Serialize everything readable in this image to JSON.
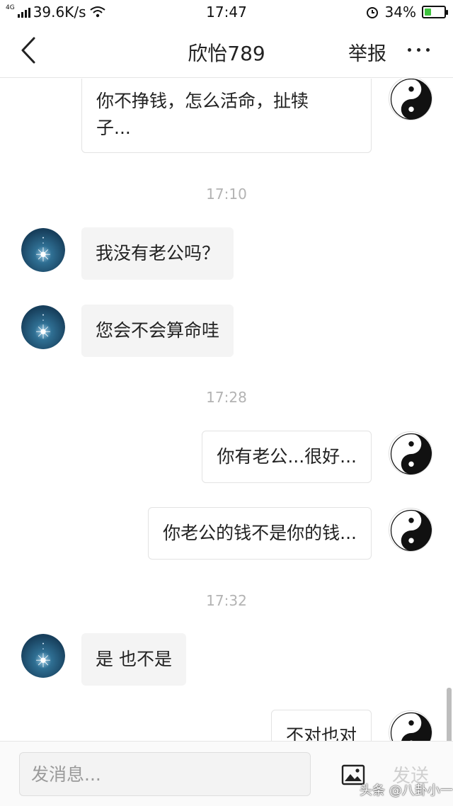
{
  "status_bar": {
    "network": "4G",
    "speed": "39.6K/s",
    "time": "17:47",
    "battery": "34%",
    "battery_level": 0.34,
    "icons": [
      "signal-icon",
      "wifi-icon",
      "alarm-icon",
      "battery-charging-icon"
    ]
  },
  "header": {
    "back_icon": "chevron-left-icon",
    "title": "欣怡789",
    "report_label": "举报",
    "more_icon": "more-dots-icon"
  },
  "messages": [
    {
      "side": "out",
      "text": "你不挣钱，怎么活命，扯犊子...",
      "lines": [
        "你不挣钱，怎么活命，扯犊",
        "子..."
      ]
    },
    {
      "timestamp": "17:10"
    },
    {
      "side": "in",
      "text": "我没有老公吗？"
    },
    {
      "side": "in",
      "text": "您会不会算命哇"
    },
    {
      "timestamp": "17:28"
    },
    {
      "side": "out",
      "text": "你有老公...很好..."
    },
    {
      "side": "out",
      "text": "你老公的钱不是你的钱..."
    },
    {
      "timestamp": "17:32"
    },
    {
      "side": "in",
      "text": "是 也不是"
    },
    {
      "side": "out",
      "text": "不对也对"
    }
  ],
  "input_bar": {
    "placeholder": "发消息...",
    "image_icon": "image-icon",
    "send_label": "发送"
  },
  "watermark": "头条 @八卦小一",
  "colors": {
    "incoming_bubble": "#f4f4f4",
    "outgoing_bubble": "#ffffff",
    "timestamp": "#b3b3b3",
    "send_disabled": "#cfcfcf",
    "battery_fill": "#3ec23e"
  }
}
